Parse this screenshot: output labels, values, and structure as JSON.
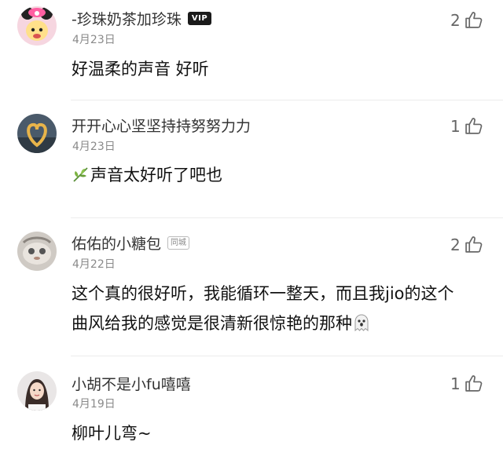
{
  "comments": [
    {
      "username": "-珍珠奶茶加珍珠",
      "badge": "VIP",
      "date": "4月23日",
      "likes": "2",
      "text": "好温柔的声音 好听"
    },
    {
      "username": "开开心心坚坚持持努努力力",
      "date": "4月23日",
      "likes": "1",
      "text": "声音太好听了吧也"
    },
    {
      "username": "佑佑的小糖包",
      "badge": "同城",
      "date": "4月22日",
      "likes": "2",
      "text_line1": "这个真的很好听，我能循环一整天，而且我jio的这个",
      "text_line2": "曲风给我的感觉是很清新很惊艳的那种"
    },
    {
      "username": "小胡不是小fu嘻嘻",
      "date": "4月19日",
      "likes": "1",
      "text": "柳叶儿弯~"
    }
  ],
  "icons": {
    "like": "thumbs-up-icon",
    "leaf": "herb-emoji-icon",
    "ghost": "ghost-emoji-icon"
  },
  "colors": {
    "username": "#333333",
    "date": "#8a8a8a",
    "like": "#666666",
    "divider": "#ececec"
  }
}
